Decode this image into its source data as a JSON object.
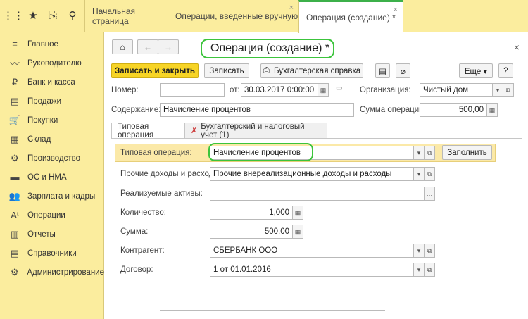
{
  "tabs": [
    {
      "label": "Начальная страница"
    },
    {
      "label": "Операции, введенные вручную",
      "close": "×"
    },
    {
      "label": "Операция (создание) *",
      "close": "×"
    }
  ],
  "sidebar": {
    "items": [
      {
        "label": "Главное",
        "icon": "≡"
      },
      {
        "label": "Руководителю",
        "icon": "〰"
      },
      {
        "label": "Банк и касса",
        "icon": "₽"
      },
      {
        "label": "Продажи",
        "icon": "▤"
      },
      {
        "label": "Покупки",
        "icon": "🛒"
      },
      {
        "label": "Склад",
        "icon": "▦"
      },
      {
        "label": "Производство",
        "icon": "⚙"
      },
      {
        "label": "ОС и НМА",
        "icon": "▬"
      },
      {
        "label": "Зарплата и кадры",
        "icon": "👥"
      },
      {
        "label": "Операции",
        "icon": "Aᵗ"
      },
      {
        "label": "Отчеты",
        "icon": "▥"
      },
      {
        "label": "Справочники",
        "icon": "▤"
      },
      {
        "label": "Администрирование",
        "icon": "⚙"
      }
    ]
  },
  "form": {
    "title": "Операция (создание) *",
    "close": "×",
    "toolbar": {
      "save_close": "Записать и закрыть",
      "save": "Записать",
      "report": "Бухгалтерская справка",
      "more": "Еще ▾",
      "help": "?"
    },
    "number_label": "Номер:",
    "number_value": "",
    "date_label": "от:",
    "date_value": "30.03.2017  0:00:00",
    "org_label": "Организация:",
    "org_value": "Чистый дом",
    "content_label": "Содержание:",
    "content_value": "Начисление процентов",
    "sum_label": "Сумма операции:",
    "sum_value": "500,00",
    "subtabs": [
      "Типовая операция",
      "Бухгалтерский и налоговый учет (1)"
    ],
    "typical_label": "Типовая операция:",
    "typical_value": "Начисление процентов",
    "fill_button": "Заполнить",
    "other_label": "Прочие доходы и расходы:",
    "other_value": "Прочие внереализационные доходы и расходы",
    "assets_label": "Реализуемые активы:",
    "assets_value": "",
    "qty_label": "Количество:",
    "qty_value": "1,000",
    "amount_label": "Сумма:",
    "amount_value": "500,00",
    "counterparty_label": "Контрагент:",
    "counterparty_value": "СБЕРБАНК ООО",
    "contract_label": "Договор:",
    "contract_value": "1 от 01.01.2016"
  },
  "colors": {
    "panel": "#fbed9e",
    "accent": "#f7d426",
    "highlight": "#3cc43c"
  }
}
